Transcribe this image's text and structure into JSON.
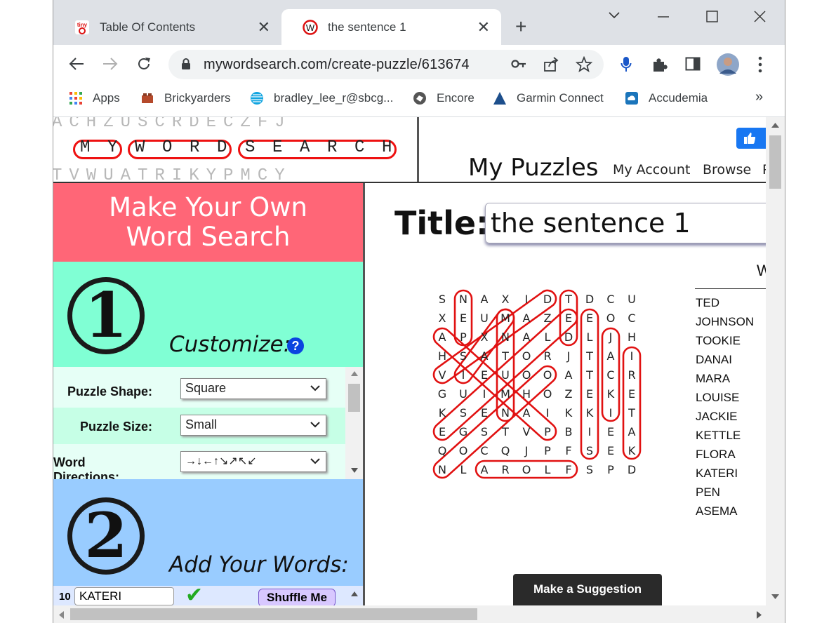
{
  "browser": {
    "tabs": [
      {
        "label": "Table Of Contents",
        "active": false,
        "favicon": "tiny-icon"
      },
      {
        "label": "the sentence 1",
        "active": true,
        "favicon": "mywordsearch-w-icon"
      }
    ],
    "new_tab_symbol": "+",
    "close_symbol": "✕",
    "url": "mywordsearch.com/create-puzzle/613674"
  },
  "bookmarks": [
    {
      "label": "Apps",
      "icon": "apps-grid-icon"
    },
    {
      "label": "Brickyarders",
      "icon": "brick-icon"
    },
    {
      "label": "bradley_lee_r@sbcg...",
      "icon": "att-globe-icon"
    },
    {
      "label": "Encore",
      "icon": "encore-icon"
    },
    {
      "label": "Garmin Connect",
      "icon": "garmin-triangle-icon"
    },
    {
      "label": "Accudemia",
      "icon": "cloud-icon"
    }
  ],
  "bookmarks_more": "»",
  "header": {
    "logo_words": [
      "MY",
      "WORD",
      "SEARCH"
    ],
    "logo_rows": [
      "ACHZUSCRDECZFJ",
      "TVWUATRIKYPMCY"
    ],
    "title": "My Puzzles",
    "links": [
      "My Account",
      "Browse",
      "P"
    ]
  },
  "left_panel": {
    "heading_line1": "Make Your Own",
    "heading_line2": "Word Search",
    "step1": {
      "number": "1",
      "label": "Customize:",
      "help": "?"
    },
    "options": [
      {
        "label": "Puzzle Shape:",
        "value": "Square"
      },
      {
        "label": "Puzzle Size:",
        "value": "Small"
      },
      {
        "label": "Word Directions:",
        "value": "→↓←↑↘↗↖↙"
      }
    ],
    "step2": {
      "number": "2",
      "label": "Add Your Words:"
    },
    "word_row": {
      "number": "10",
      "value": "KATERI",
      "check": "✔",
      "button": "Shuffle Me"
    }
  },
  "main": {
    "title_label": "Title:",
    "title_value": "the sentence 1",
    "grid": [
      "SNAXIDTDCU",
      "XEUMAZEEOC",
      "APXNALDLJH",
      "HSATORJTAI",
      "VIEUOOATCR",
      "GUIMHOZEKE",
      "KSENAIKKIT",
      "EGSTVPBIEA",
      "QOCQJPFSEK",
      "NLAROLFSPD"
    ],
    "word_list_heading": "W",
    "words": [
      "TED",
      "JOHNSON",
      "TOOKIE",
      "DANAI",
      "MARA",
      "LOUISE",
      "JACKIE",
      "KETTLE",
      "FLORA",
      "KATERI",
      "PEN",
      "ASEMA"
    ],
    "suggest_button": "Make a Suggestion"
  },
  "colors": {
    "tabstrip": "#dee1e6",
    "make_header": "#ff6677",
    "step1_bg": "#80ffd4",
    "step2_bg": "#99ccff",
    "highlight_red": "#e11111"
  }
}
